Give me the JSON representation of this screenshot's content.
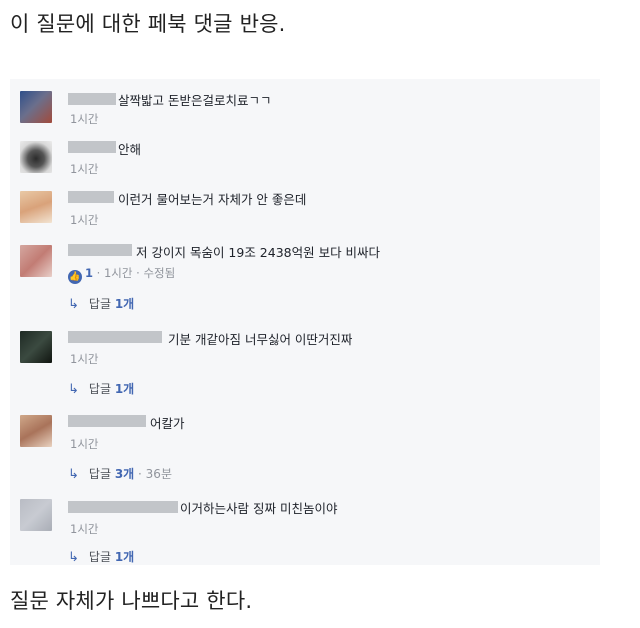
{
  "caption_top": "이 질문에 대한 페북 댓글 반응.",
  "caption_bottom": "질문 자체가 나쁘다고 한다.",
  "comments": [
    {
      "text": "살짝밟고 돈받은걸로치료ㄱㄱ",
      "time": "1시간"
    },
    {
      "text": "안해",
      "time": "1시간"
    },
    {
      "text": "이런거 물어보는거 자체가 안 좋은데",
      "time": "1시간"
    },
    {
      "text": "저 강이지 목숨이 19조 2438억원 보다 비싸다",
      "likes": "1",
      "time": "1시간",
      "edited": "수정됨",
      "reply": {
        "label": "답글",
        "count": "1개"
      }
    },
    {
      "text": "기분 개같아짐 너무싫어 이딴거진짜",
      "time": "1시간",
      "reply": {
        "label": "답글",
        "count": "1개"
      }
    },
    {
      "text": "어칼가",
      "time": "1시간",
      "reply": {
        "label": "답글",
        "count": "3개",
        "time": "36분"
      }
    },
    {
      "text": "이거하는사람 징짜 미친놈이야",
      "time": "1시간",
      "reply": {
        "label": "답글",
        "count": "1개"
      }
    }
  ],
  "colors": {
    "accent": "#4267b2",
    "panel_bg": "#f6f7f9",
    "meta": "#90949c"
  },
  "icons": [
    "reply-arrow-icon",
    "like-icon"
  ]
}
